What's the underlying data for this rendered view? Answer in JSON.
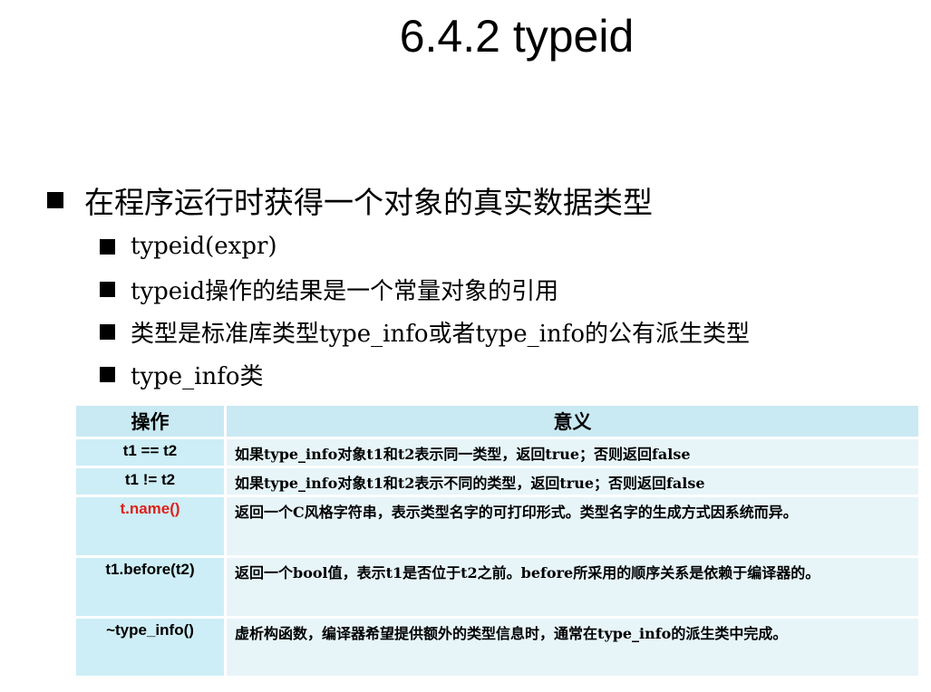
{
  "slide": {
    "title": "6.4.2 typeid"
  },
  "bullets": {
    "main": "在程序运行时获得一个对象的真实数据类型",
    "sub": [
      "typeid(expr)",
      "typeid操作的结果是一个常量对象的引用",
      "类型是标准库类型type_info或者type_info的公有派生类型",
      "type_info类"
    ]
  },
  "table": {
    "headers": [
      "操作",
      "意义"
    ],
    "rows": [
      {
        "op": "t1 == t2",
        "meaning": "如果type_info对象t1和t2表示同一类型，返回true；否则返回false"
      },
      {
        "op": "t1 != t2",
        "meaning": "如果type_info对象t1和t2表示不同的类型，返回true；否则返回false"
      },
      {
        "op": "t.name()",
        "meaning": "返回一个C风格字符串，表示类型名字的可打印形式。类型名字的生成方式因系统而异。"
      },
      {
        "op": "t1.before(t2)",
        "meaning": "返回一个bool值，表示t1是否位于t2之前。before所采用的顺序关系是依赖于编译器的。"
      },
      {
        "op": "~type_info()",
        "meaning": "虚析构函数，编译器希望提供额外的类型信息时，通常在type_info的派生类中完成。"
      }
    ]
  },
  "colors": {
    "header_bg": "#c9e9f3",
    "op_cell_bg": "#cdeef6",
    "meaning_cell_bg": "#e7f5f9",
    "highlight_text": "#e0201a"
  }
}
